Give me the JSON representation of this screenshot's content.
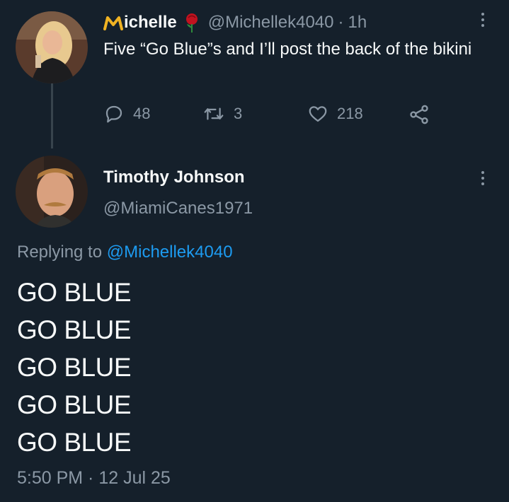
{
  "parent_tweet": {
    "display_name": "Michelle",
    "emoji": "rose-emoji",
    "handle": "@Michellek4040",
    "separator": "·",
    "time": "1h",
    "text": "Five “Go Blue”s and I’ll post the back of the bikini",
    "replies": "48",
    "retweets": "3",
    "likes": "218"
  },
  "reply_tweet": {
    "display_name": "Timothy Johnson",
    "handle": "@MiamiCanes1971",
    "replying_label": "Replying to",
    "replying_to": "@Michellek4040",
    "lines": [
      "GO BLUE",
      "GO BLUE",
      "GO BLUE",
      "GO BLUE",
      "GO BLUE"
    ],
    "timestamp": "5:50 PM · 12 Jul 25"
  },
  "colors": {
    "background": "#15202b",
    "text": "#f7f9f9",
    "muted": "#8b98a5",
    "link": "#1d9bf0",
    "thread_line": "#38444d",
    "gold_m": "#f0b323",
    "rose": "#c1121f"
  }
}
